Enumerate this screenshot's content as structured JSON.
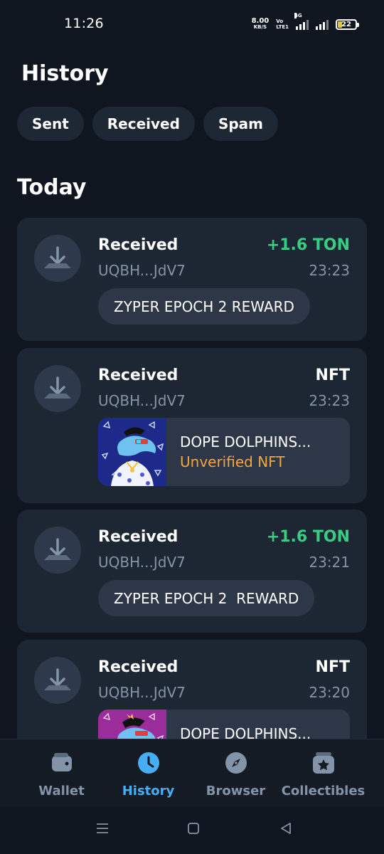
{
  "status_bar": {
    "time": "11:26",
    "net_speed": "8.00",
    "net_unit": "KB/S",
    "volte_top": "Vo",
    "volte_bottom": "LTE1",
    "network": "4G",
    "battery": "22"
  },
  "header": {
    "title": "History",
    "filters": [
      "Sent",
      "Received",
      "Spam"
    ]
  },
  "section_title": "Today",
  "transactions": [
    {
      "title": "Received",
      "amount": "+1.6 TON",
      "address": "UQBH...JdV7",
      "time": "23:23",
      "comment": "ZYPER EPOCH 2 REWARD"
    },
    {
      "title": "Received",
      "amount": "NFT",
      "address": "UQBH...JdV7",
      "time": "23:23",
      "nft_name": "DOPE DOLPHINS...",
      "nft_status": "Unverified NFT"
    },
    {
      "title": "Received",
      "amount": "+1.6 TON",
      "address": "UQBH...JdV7",
      "time": "23:21",
      "comment": "ZYPER EPOCH 2  REWARD"
    },
    {
      "title": "Received",
      "amount": "NFT",
      "address": "UQBH...JdV7",
      "time": "23:20",
      "nft_name": "DOPE DOLPHINS..."
    }
  ],
  "bottom_nav": [
    {
      "label": "Wallet",
      "icon": "wallet-icon",
      "active": false
    },
    {
      "label": "History",
      "icon": "clock-icon",
      "active": true
    },
    {
      "label": "Browser",
      "icon": "compass-icon",
      "active": false
    },
    {
      "label": "Collectibles",
      "icon": "star-box-icon",
      "active": false
    }
  ],
  "colors": {
    "background": "#10161f",
    "card": "#1d2633",
    "positive": "#39cc83",
    "accent": "#45aef5",
    "warning": "#f5a73b",
    "muted": "#8494a8"
  }
}
